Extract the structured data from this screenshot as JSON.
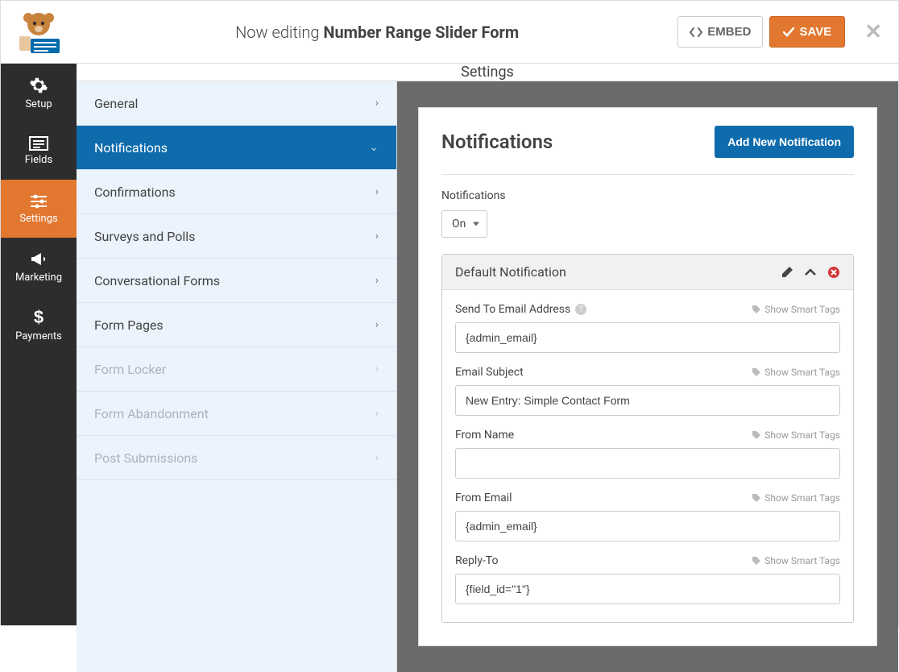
{
  "topbar": {
    "editing_prefix": "Now editing ",
    "form_name": "Number Range Slider Form",
    "embed_label": "EMBED",
    "save_label": "SAVE"
  },
  "leftnav": {
    "items": [
      {
        "label": "Setup"
      },
      {
        "label": "Fields"
      },
      {
        "label": "Settings"
      },
      {
        "label": "Marketing"
      },
      {
        "label": "Payments"
      }
    ]
  },
  "settings_header": "Settings",
  "settings_list": {
    "items": [
      {
        "label": "General",
        "disabled": false
      },
      {
        "label": "Notifications",
        "disabled": false,
        "active": true
      },
      {
        "label": "Confirmations",
        "disabled": false
      },
      {
        "label": "Surveys and Polls",
        "disabled": false
      },
      {
        "label": "Conversational Forms",
        "disabled": false
      },
      {
        "label": "Form Pages",
        "disabled": false
      },
      {
        "label": "Form Locker",
        "disabled": true
      },
      {
        "label": "Form Abandonment",
        "disabled": true
      },
      {
        "label": "Post Submissions",
        "disabled": true
      }
    ]
  },
  "content": {
    "title": "Notifications",
    "add_button": "Add New Notification",
    "notif_toggle_label": "Notifications",
    "notif_toggle_value": "On",
    "notification": {
      "title": "Default Notification",
      "smart_tags_label": "Show Smart Tags",
      "fields": {
        "send_to": {
          "label": "Send To Email Address",
          "value": "{admin_email}",
          "help": true
        },
        "subject": {
          "label": "Email Subject",
          "value": "New Entry: Simple Contact Form"
        },
        "from_name": {
          "label": "From Name",
          "value": ""
        },
        "from_email": {
          "label": "From Email",
          "value": "{admin_email}"
        },
        "reply_to": {
          "label": "Reply-To",
          "value": "{field_id=\"1\"}"
        }
      }
    }
  }
}
